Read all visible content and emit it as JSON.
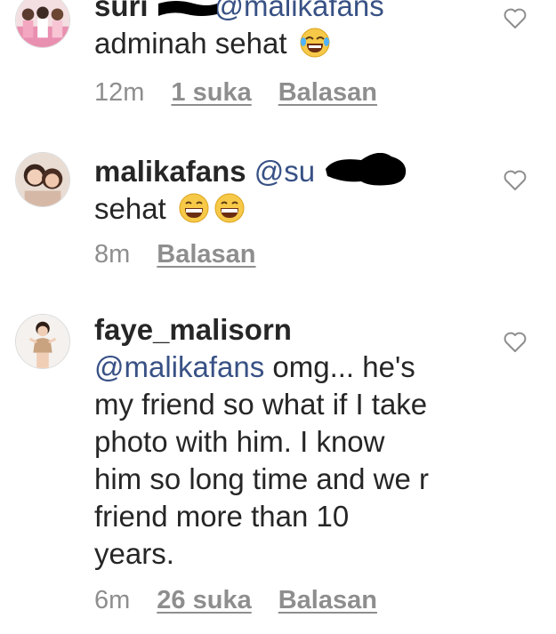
{
  "comments": [
    {
      "username": "suri",
      "mention": "@malikafans",
      "text": "adminah sehat",
      "emoji": "laughing-crying-emoji",
      "time": "12m",
      "likes": "1 suka",
      "reply": "Balasan"
    },
    {
      "username": "malikafans",
      "mention": "@su",
      "text": "sehat",
      "emoji": "grinning-emoji",
      "time": "8m",
      "reply": "Balasan"
    },
    {
      "username": "faye_malisorn",
      "mention": "@malikafans",
      "text_lines": [
        " omg... he's",
        "my friend so what if I take",
        "photo with him. I know",
        "him so long time and we r",
        "friend more than 10",
        "years."
      ],
      "time": "6m",
      "likes": "26 suka",
      "reply": "Balasan"
    }
  ],
  "colors": {
    "text": "#262626",
    "mention": "#385185",
    "meta": "#8e8e8e",
    "heart": "#8e8e8e",
    "redaction": "#000000"
  }
}
